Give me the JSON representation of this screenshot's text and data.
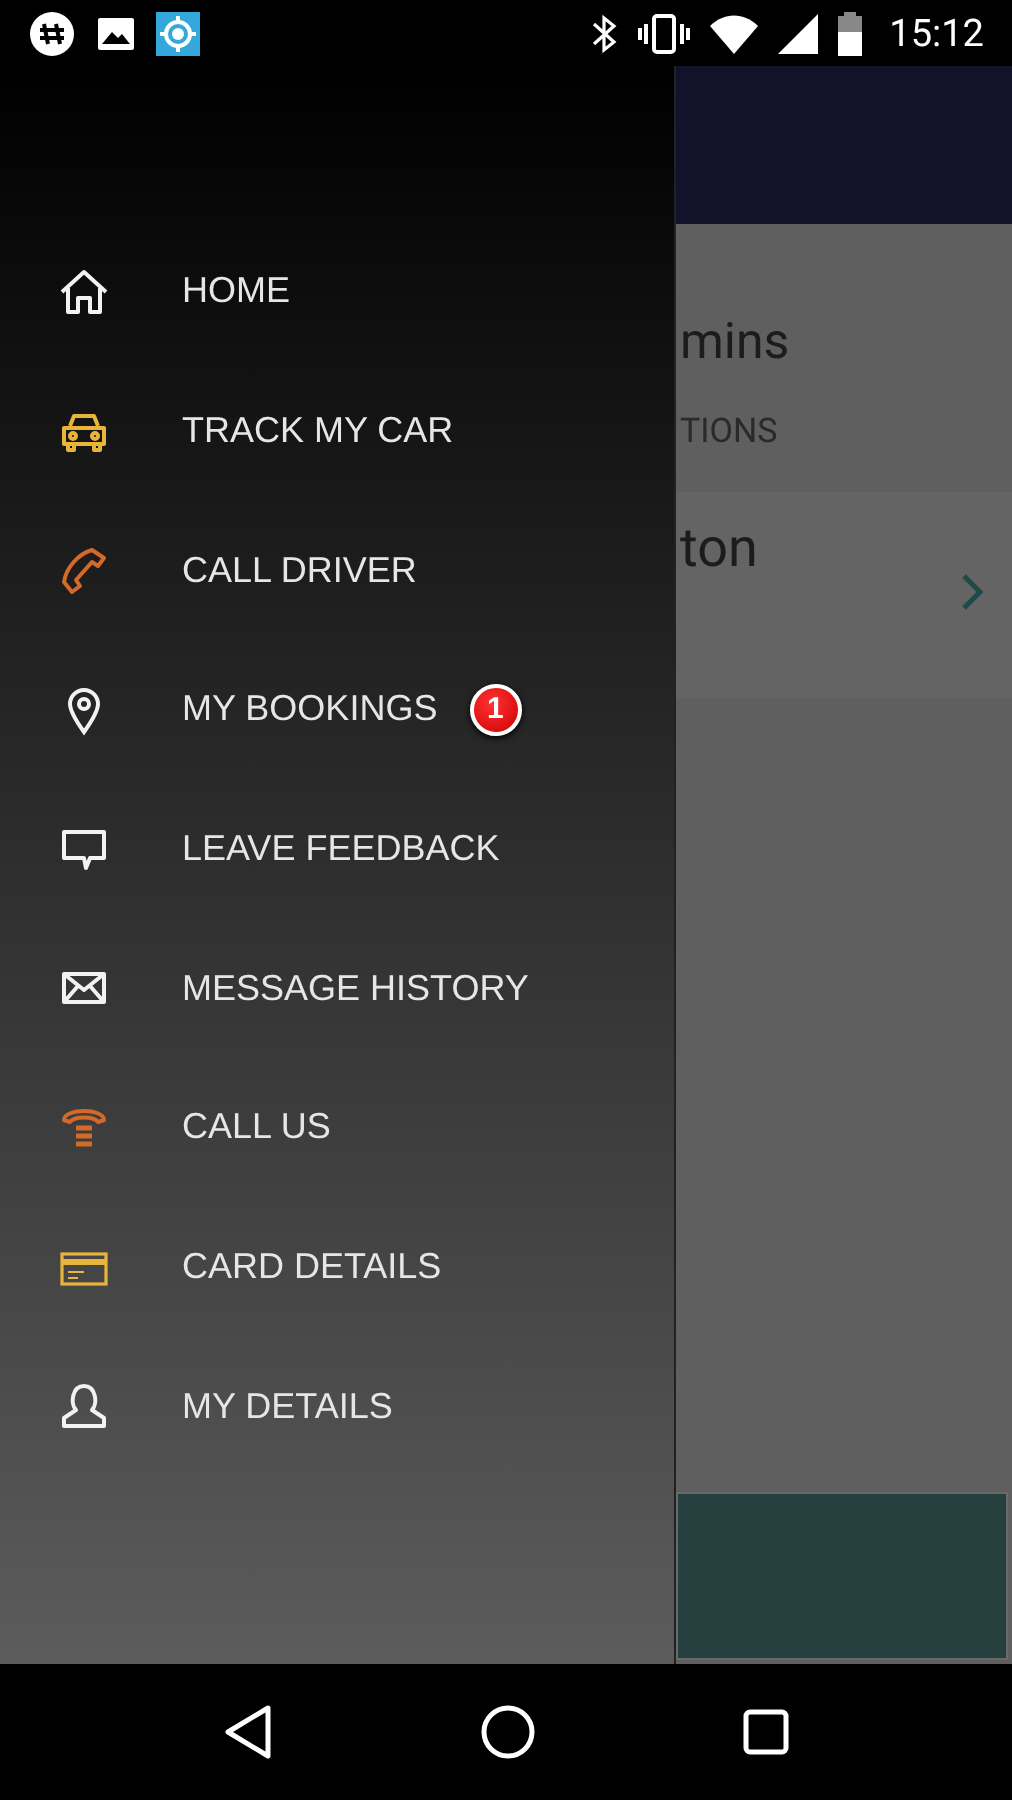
{
  "status_bar": {
    "time": "15:12"
  },
  "drawer": {
    "items": [
      {
        "label": "HOME"
      },
      {
        "label": "TRACK MY CAR"
      },
      {
        "label": "CALL DRIVER"
      },
      {
        "label": "MY BOOKINGS",
        "badge": "1"
      },
      {
        "label": "LEAVE FEEDBACK"
      },
      {
        "label": "MESSAGE HISTORY"
      },
      {
        "label": "CALL US"
      },
      {
        "label": "CARD DETAILS"
      },
      {
        "label": "MY DETAILS"
      }
    ]
  },
  "background_screen": {
    "eta_text": "mins",
    "section_label": "TIONS",
    "row_text": "ton"
  }
}
